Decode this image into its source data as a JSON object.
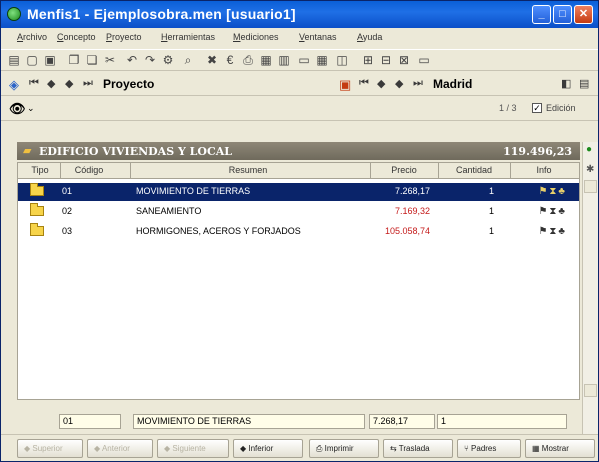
{
  "window": {
    "title": "Menfis1 - Ejemplosobra.men  [usuario1]",
    "minimize": "_",
    "maximize": "□",
    "close": "✕"
  },
  "menu": [
    "Archivo",
    "Concepto",
    "Proyecto",
    "Herramientas",
    "Mediciones",
    "Ventanas",
    "Ayuda"
  ],
  "navbar": {
    "left_label": "Proyecto",
    "right_label": "Madrid"
  },
  "search": {
    "page": "1 / 3",
    "edicion_label": "Edición"
  },
  "chapter": {
    "title": "EDIFICIO VIVIENDAS Y LOCAL",
    "total": "119.496,23"
  },
  "table": {
    "columns": [
      "Tipo",
      "Código",
      "Resumen",
      "Precio",
      "Cantidad",
      "Info"
    ],
    "rows": [
      {
        "code": "01",
        "summary": "MOVIMIENTO DE TIERRAS",
        "price": "7.268,17",
        "qty": "1",
        "selected": true
      },
      {
        "code": "02",
        "summary": "SANEAMIENTO",
        "price": "7.169,32",
        "qty": "1",
        "selected": false
      },
      {
        "code": "03",
        "summary": "HORMIGONES, ACEROS Y FORJADOS",
        "price": "105.058,74",
        "qty": "1",
        "selected": false
      }
    ]
  },
  "statusline": {
    "code": "01",
    "summary": "MOVIMIENTO DE TIERRAS",
    "price": "7.268,17",
    "qty": "1"
  },
  "bottom_buttons": [
    "Superior",
    "Anterior",
    "Siguiente",
    "Inferior",
    "Imprimir",
    "Traslada",
    "Padres",
    "Mostrar"
  ]
}
